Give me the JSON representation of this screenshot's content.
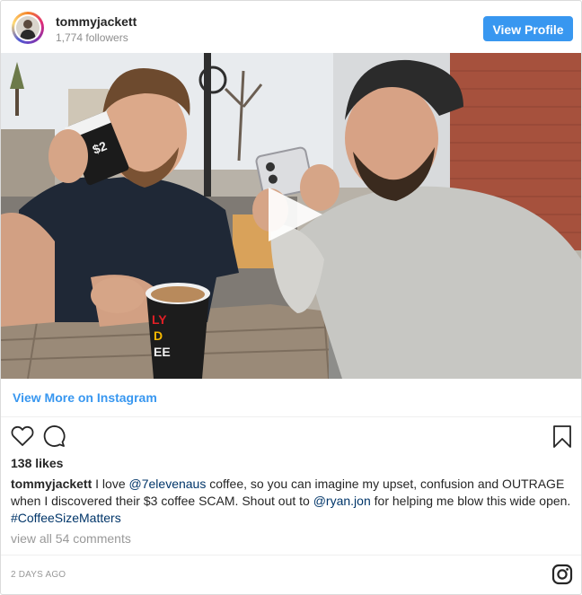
{
  "profile": {
    "username": "tommyjackett",
    "followers": "1,774 followers",
    "view_profile_label": "View Profile"
  },
  "media": {
    "type": "video",
    "cup_print_left": "$2",
    "cup_print_front": "LY\nD\nEE"
  },
  "links": {
    "view_more": "View More on Instagram"
  },
  "stats": {
    "likes": "138 likes",
    "view_comments": "view all 54 comments",
    "timestamp": "2 DAYS AGO"
  },
  "caption": {
    "username": "tommyjackett",
    "t1": " I love ",
    "m1": "@7elevenaus",
    "t2": " coffee, so you can imagine my upset, confusion and OUTRAGE when I discovered their $3 coffee SCAM. Shout out to ",
    "m2": "@ryan.jon",
    "t3": " for helping me blow this wide open. ",
    "h1": "#CoffeeSizeMatters"
  },
  "colors": {
    "accent": "#3897f0",
    "link": "#003569",
    "muted": "#999999",
    "border": "#dbdbdb"
  },
  "icons": [
    "heart-icon",
    "comment-icon",
    "bookmark-icon",
    "play-icon",
    "instagram-logo-icon"
  ]
}
